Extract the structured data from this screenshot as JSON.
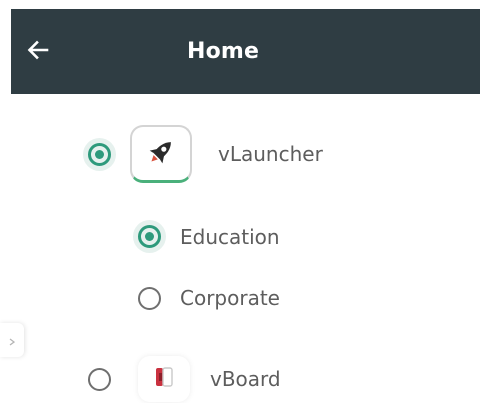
{
  "header": {
    "title": "Home",
    "back_icon": "arrow-left-icon"
  },
  "launchers": [
    {
      "label": "vLauncher",
      "selected": true,
      "icon": "rocket-icon",
      "modes": [
        {
          "label": "Education",
          "selected": true
        },
        {
          "label": "Corporate",
          "selected": false
        }
      ]
    },
    {
      "label": "vBoard",
      "selected": false,
      "icon": "vboard-logo-icon"
    }
  ],
  "colors": {
    "topbar": "#2f3d43",
    "accent": "#2e9a7c",
    "text": "#5d5d5d"
  }
}
